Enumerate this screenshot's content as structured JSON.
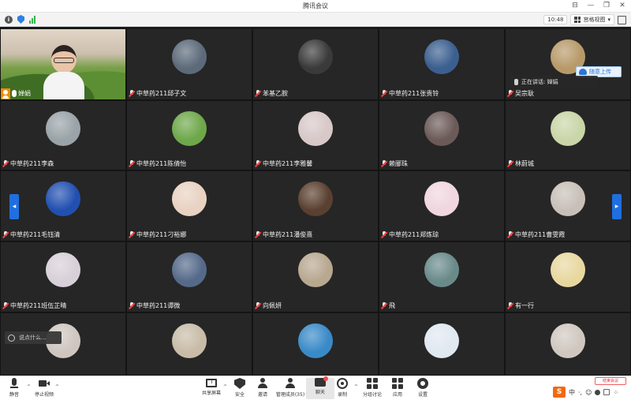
{
  "window": {
    "title": "腾讯会议"
  },
  "statusbar": {
    "time": "10:48",
    "view_label": "宫格视图"
  },
  "overlays": {
    "speaking": "正在讲话: 婵娟",
    "cloud_upload": "随意上传",
    "chat_placeholder": "说点什么...",
    "leave_label": "结束会议"
  },
  "participants": [
    {
      "name": "婵娟",
      "self": true
    },
    {
      "name": "中草药211邱子文",
      "avatar": "#5c6a7a"
    },
    {
      "name": "苯基乙胺",
      "avatar": "#3a3a3a"
    },
    {
      "name": "中草药211张贵铃",
      "avatar": "#3b5f8f"
    },
    {
      "name": "吴宗耿",
      "avatar": "#b89a6a"
    },
    {
      "name": "中草药211李森",
      "avatar": "#9aa3a8"
    },
    {
      "name": "中草药211陈倩怡",
      "avatar": "#6ea84a"
    },
    {
      "name": "中草药211李雅馨",
      "avatar": "#d8c8c8"
    },
    {
      "name": "赖郦珠",
      "avatar": "#6b5a58"
    },
    {
      "name": "林蔚城",
      "avatar": "#c9d6a8"
    },
    {
      "name": "中草药211毛钰清",
      "avatar": "#2250b0"
    },
    {
      "name": "中草药211刁裕娜",
      "avatar": "#e8d2c2"
    },
    {
      "name": "中草药211潘俊熹",
      "avatar": "#5a4030"
    },
    {
      "name": "中草药211郑炼琼",
      "avatar": "#f0d6de"
    },
    {
      "name": "中草药211曹雯霞",
      "avatar": "#c8c0b8"
    },
    {
      "name": "中草药211班伍芷晴",
      "avatar": "#d8d0d8"
    },
    {
      "name": "中草药211谭微",
      "avatar": "#556a8a"
    },
    {
      "name": "向佩妍",
      "avatar": "#b8a890"
    },
    {
      "name": "飛",
      "avatar": "#6a8a8a"
    },
    {
      "name": "有一行",
      "avatar": "#e8d8a0"
    },
    {
      "name": "",
      "avatar": "#cfc6c0"
    },
    {
      "name": "",
      "avatar": "#c8bca8"
    },
    {
      "name": "",
      "avatar": "#3a8ac8"
    },
    {
      "name": "",
      "avatar": "#e0e8f0"
    },
    {
      "name": "",
      "avatar": "#d0c8c0"
    }
  ],
  "toolbar": {
    "mute": "静音",
    "stop_video": "停止视频",
    "share_screen": "共享屏幕",
    "security": "安全",
    "invite": "邀请",
    "manage_members": "管理成员(35)",
    "chat": "聊天",
    "record": "录制",
    "breakout": "分组讨论",
    "apps": "应用",
    "settings": "设置"
  },
  "ime": {
    "lang": "中"
  }
}
